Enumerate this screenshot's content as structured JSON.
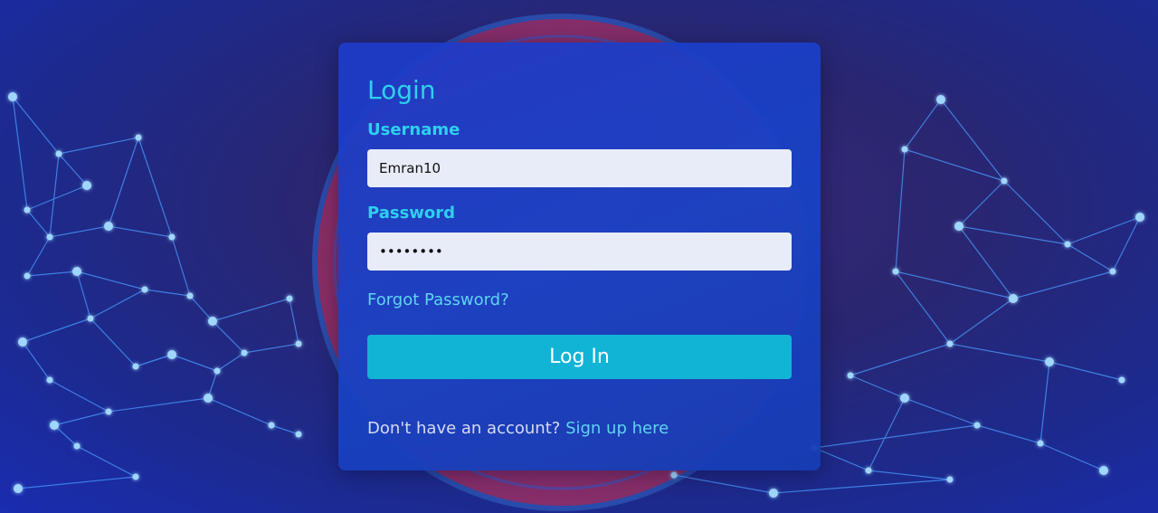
{
  "login": {
    "title": "Login",
    "username_label": "Username",
    "username_value": "Emran10",
    "password_label": "Password",
    "password_value": "12345678",
    "forgot_label": "Forgot Password?",
    "submit_label": "Log In",
    "signup_prompt": "Don't have an account?",
    "signup_link": "Sign up here"
  },
  "colors": {
    "accent": "#2ed0ee",
    "button": "#12b4d6",
    "card": "#1e3ac8",
    "input_bg": "#e8ecf8",
    "background": "#2a2670"
  }
}
